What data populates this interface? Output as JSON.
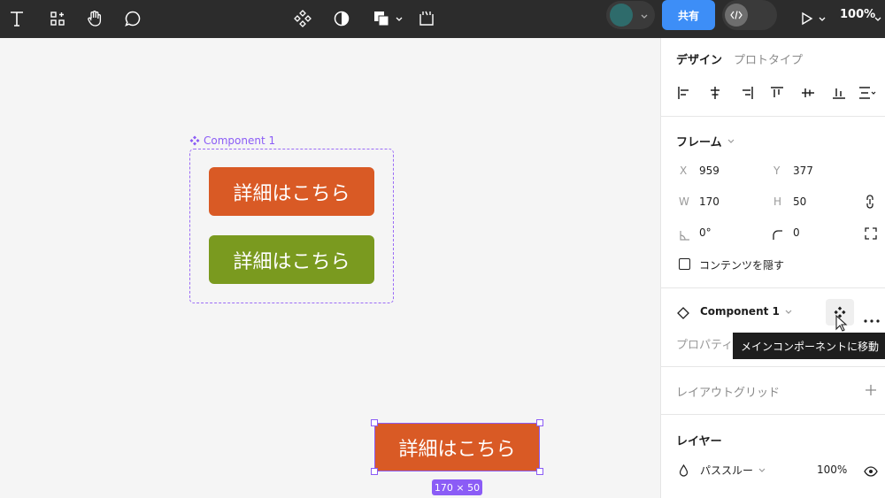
{
  "toolbar": {
    "icons": [
      "text-tool-icon",
      "resources-icon",
      "hand-tool-icon",
      "comment-icon",
      "component-icon",
      "contrast-icon",
      "boolean-icon",
      "crop-icon"
    ],
    "share_label": "共有",
    "zoom": "100%",
    "avatar_color": "#2e6b6b"
  },
  "canvas": {
    "component_name": "Component 1",
    "buttons": [
      {
        "label": "詳細はこちら",
        "color": "#d95a25"
      },
      {
        "label": "詳細はこちら",
        "color": "#7a9a1f"
      }
    ],
    "instance_label": "詳細はこちら",
    "size_badge": "170 × 50",
    "selection_color": "#8b5cf6"
  },
  "panel": {
    "tabs": [
      {
        "label": "デザイン",
        "active": true
      },
      {
        "label": "プロトタイプ",
        "active": false
      }
    ],
    "frame": {
      "title": "フレーム",
      "x_label": "X",
      "x": "959",
      "y_label": "Y",
      "y": "377",
      "w_label": "W",
      "w": "170",
      "h_label": "H",
      "h": "50",
      "rotation": "0°",
      "radius": "0",
      "clip_label": "コンテンツを隠す"
    },
    "component": {
      "name": "Component 1",
      "properties_label": "プロパティ",
      "tooltip": "メインコンポーネントに移動"
    },
    "layout_grid": {
      "title": "レイアウトグリッド"
    },
    "layer": {
      "title": "レイヤー",
      "blend": "パススルー",
      "opacity": "100%"
    }
  }
}
